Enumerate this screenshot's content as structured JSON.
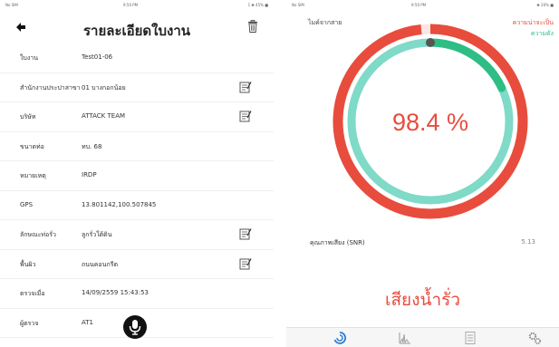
{
  "left": {
    "status": {
      "carrier": "No SIM",
      "time": "9:50 PM",
      "battery": "1 ✱ 45% ■"
    },
    "title": "รายละเอียดใบงาน",
    "rows": [
      {
        "label": "ใบงาน",
        "value": "Test01-06",
        "editable": false
      },
      {
        "label": "สำนักงานประปาสาขา",
        "value": "01 บางกอกน้อย",
        "editable": true
      },
      {
        "label": "บริษัท",
        "value": "ATTACK TEAM",
        "editable": true
      },
      {
        "label": "ขนาดท่อ",
        "value": "ทบ. 68",
        "editable": false
      },
      {
        "label": "หมายเหตุ",
        "value": "IRDP",
        "editable": false
      },
      {
        "label": "GPS",
        "value": "13.801142,100.507845",
        "editable": false
      },
      {
        "label": "ลักษณะท่อรั่ว",
        "value": "ลูกรั่วใต้ดิน",
        "editable": true
      },
      {
        "label": "พื้นผิว",
        "value": "ถนนคอนกรีต",
        "editable": true
      },
      {
        "label": "ตรวจเมื่อ",
        "value": "14/09/2559 15:43:53",
        "editable": false
      },
      {
        "label": "ผู้ตรวจ",
        "value": "AT1",
        "editable": false
      }
    ]
  },
  "right": {
    "status": {
      "carrier": "No SIM",
      "time": "9:50 PM",
      "battery": "✱ 26% ■"
    },
    "mic_label": "ไมค์จากสาย",
    "legend_prob": "ความน่าจะเป็น",
    "legend_strength": "ความดัง",
    "gauge_value": "98.4 %",
    "gauge_fraction": 0.984,
    "strength_fraction": 0.18,
    "snr_label": "คุณภาพเสียง (SNR)",
    "snr_value": "5.13",
    "result": "เสียงน้ำรั่ว",
    "colors": {
      "red": "#e84c3d",
      "teal": "#7fdac8",
      "green": "#2ebd85"
    }
  }
}
